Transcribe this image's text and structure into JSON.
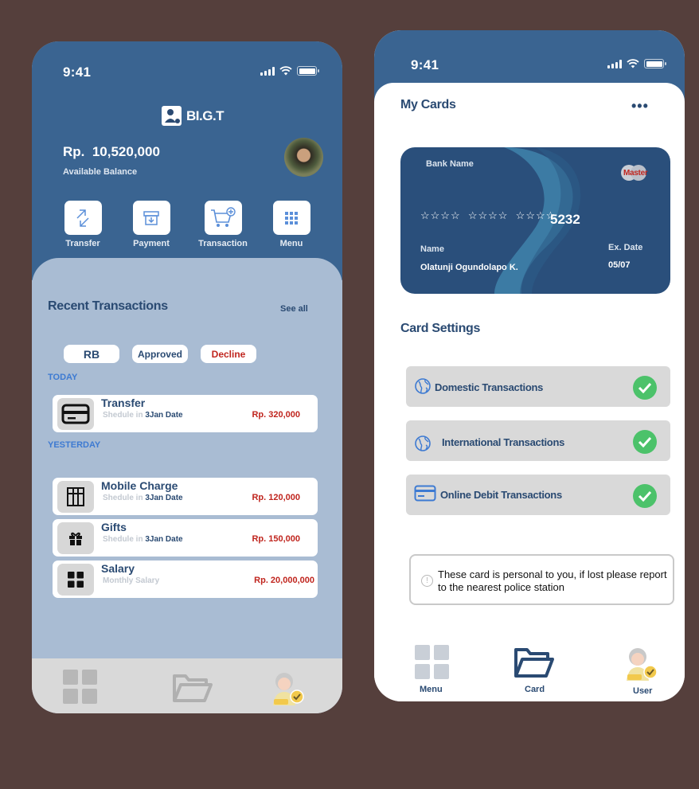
{
  "left_screen": {
    "status": {
      "time": "9:41"
    },
    "brand": "BI.G.T",
    "balance": {
      "amount": "Rp.  10,520,000",
      "label": "Available Balance"
    },
    "quick_actions": [
      "Transfer",
      "Payment",
      "Transaction",
      "Menu"
    ],
    "recent": {
      "title": "Recent Transactions",
      "see_all": "See all"
    },
    "filters": [
      "RB",
      "Approved",
      "Decline"
    ],
    "sections": {
      "today": "TODAY",
      "yesterday": "YESTERDAY"
    },
    "transactions": [
      {
        "title": "Transfer",
        "sub_prefix": "Shedule in ",
        "sub_value": "3Jan Date",
        "amount": "Rp. 320,000"
      },
      {
        "title": "Mobile Charge",
        "sub_prefix": "Shedule in ",
        "sub_value": "3Jan Date",
        "amount": "Rp. 120,000"
      },
      {
        "title": "Gifts",
        "sub_prefix": "Shedule in ",
        "sub_value": "3Jan Date",
        "amount": "Rp. 150,000"
      },
      {
        "title": "Salary",
        "sub_prefix": "Monthly Salary",
        "sub_value": "",
        "amount": "Rp. 20,000,000"
      }
    ]
  },
  "right_screen": {
    "status": {
      "time": "9:41"
    },
    "title": "My Cards",
    "more": "•••",
    "card": {
      "bank": "Bank Name",
      "brand": "Master",
      "masked": "☆☆☆☆  ☆☆☆☆  ☆☆☆☆",
      "last4": "5232",
      "name_label": "Name",
      "name": "Olatunji Ogundolapo K.",
      "exp_label": "Ex. Date",
      "exp": "05/07"
    },
    "settings_title": "Card Settings",
    "settings": [
      "Domestic Transactions",
      "International Transactions",
      "Online Debit Transactions"
    ],
    "note": "These card is personal to you, if lost please report to the nearest police station",
    "nav": [
      "Menu",
      "Card",
      "User"
    ]
  },
  "colors": {
    "primary": "#3a6491",
    "accent_red": "#c0251e",
    "check_green": "#4cc26a",
    "background": "#553f3c"
  }
}
